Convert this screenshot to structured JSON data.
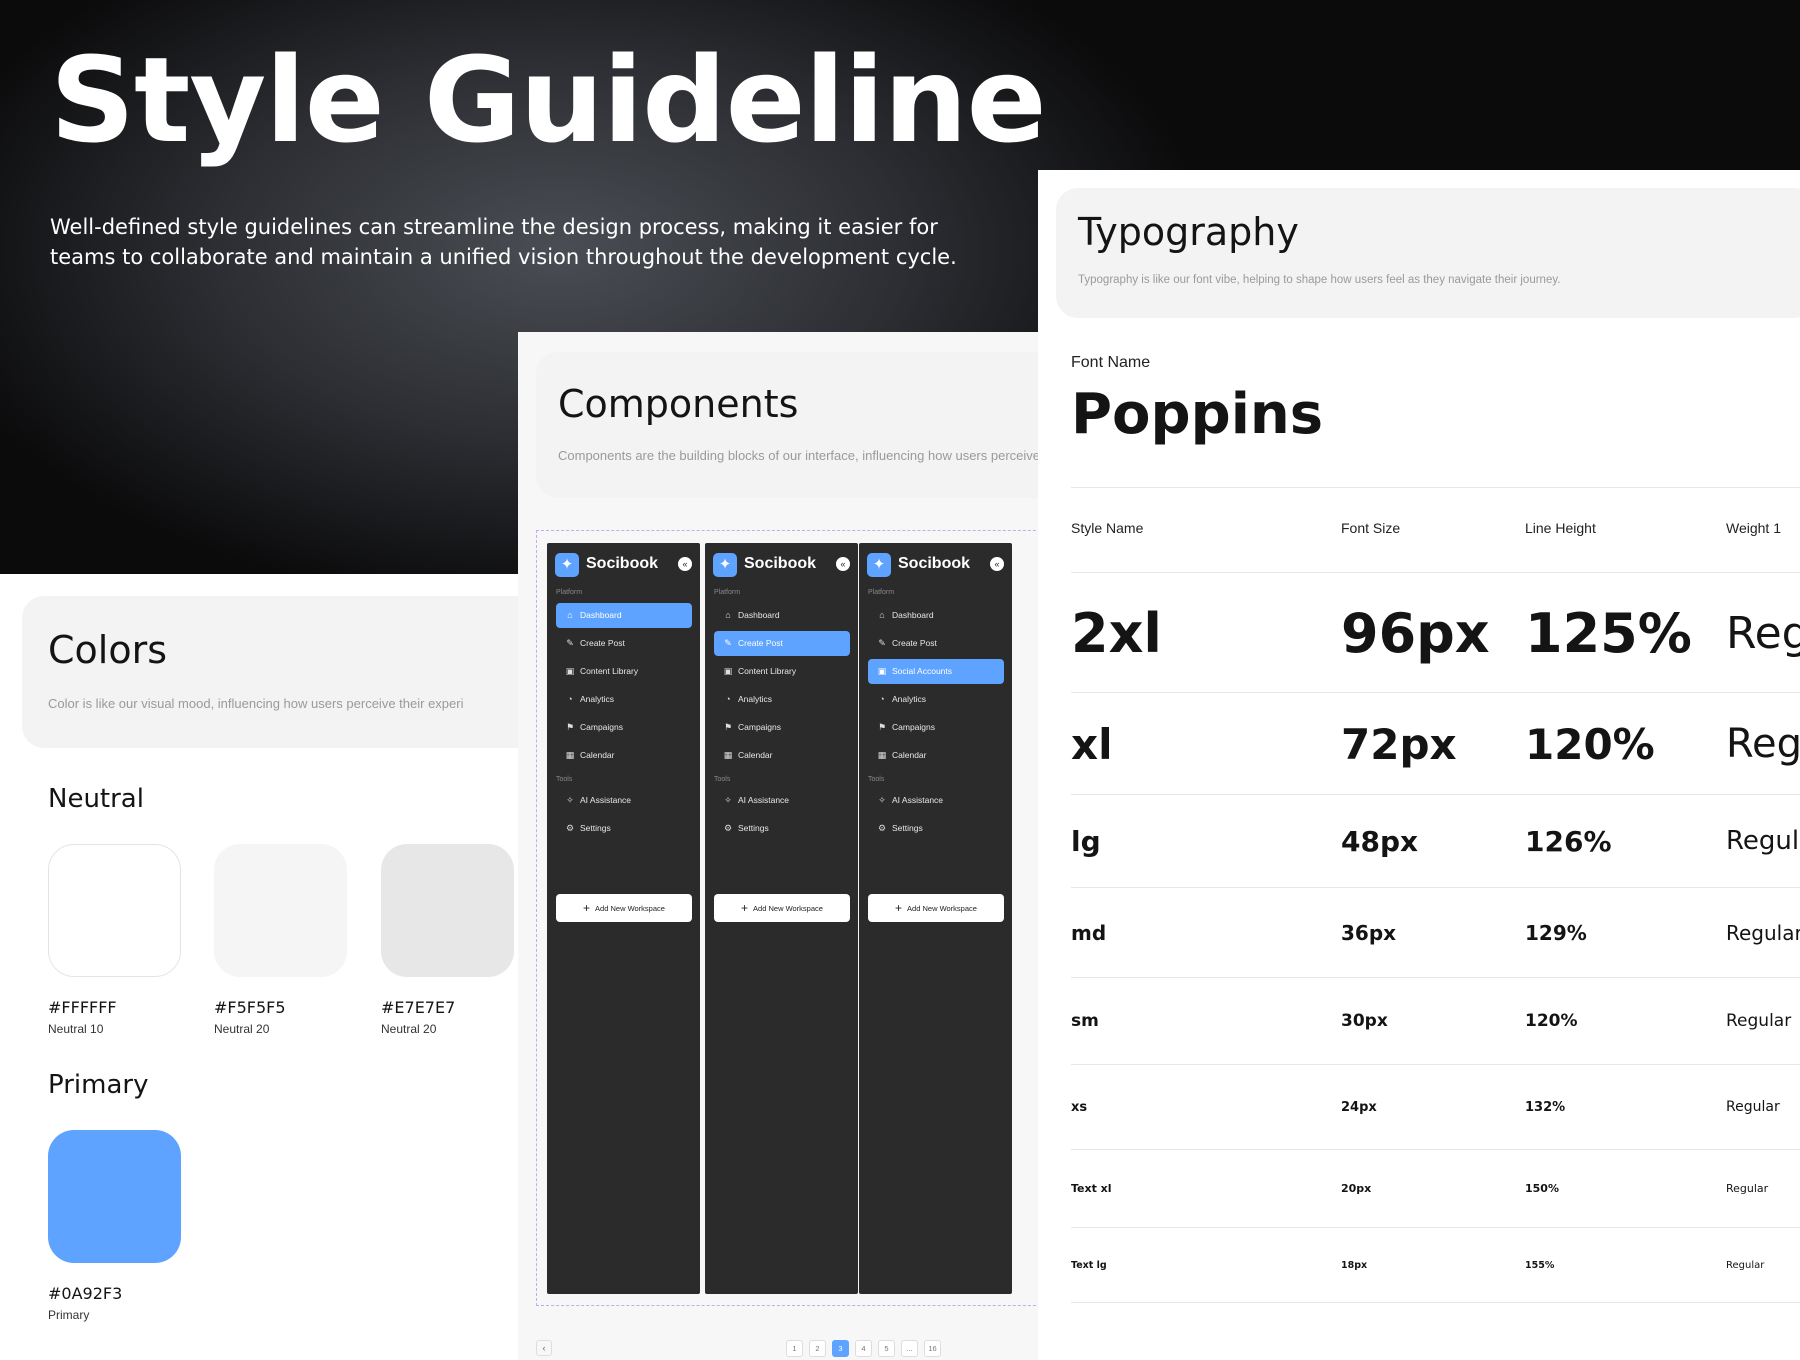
{
  "hero": {
    "title": "Style Guideline",
    "description": "Well-defined style guidelines can streamline the design process, making it easier for teams to collaborate and maintain a unified vision throughout the development cycle."
  },
  "colors": {
    "title": "Colors",
    "description": "Color is like our visual mood, influencing how users perceive their experi",
    "neutral": {
      "title": "Neutral",
      "swatches": [
        {
          "hex": "#FFFFFF",
          "name": "Neutral 10",
          "color": "#FFFFFF"
        },
        {
          "hex": "#F5F5F5",
          "name": "Neutral 20",
          "color": "#F5F5F5"
        },
        {
          "hex": "#E7E7E7",
          "name": "Neutral 20",
          "color": "#E7E7E7"
        }
      ]
    },
    "primary": {
      "title": "Primary",
      "swatches": [
        {
          "hex": "#0A92F3",
          "name": "Primary",
          "color": "#5EA3FF"
        }
      ]
    }
  },
  "components": {
    "title": "Components",
    "description": "Components are the building blocks of our interface, influencing how users perceive",
    "sidebars": [
      {
        "brand": "Socibook",
        "platform_label": "Platform",
        "tools_label": "Tools",
        "items": [
          "Dashboard",
          "Create Post",
          "Content Library",
          "Analytics",
          "Campaigns",
          "Calendar"
        ],
        "tool_items": [
          "AI Assistance",
          "Settings"
        ],
        "active": "Dashboard",
        "add_label": "Add New Workspace"
      },
      {
        "brand": "Socibook",
        "platform_label": "Platform",
        "tools_label": "Tools",
        "items": [
          "Dashboard",
          "Create Post",
          "Content Library",
          "Analytics",
          "Campaigns",
          "Calendar"
        ],
        "tool_items": [
          "AI Assistance",
          "Settings"
        ],
        "active": "Create Post",
        "add_label": "Add New Workspace"
      },
      {
        "brand": "Socibook",
        "platform_label": "Platform",
        "tools_label": "Tools",
        "items": [
          "Dashboard",
          "Create Post",
          "Social Accounts",
          "Analytics",
          "Campaigns",
          "Calendar"
        ],
        "tool_items": [
          "AI Assistance",
          "Settings"
        ],
        "active": "Social Accounts",
        "add_label": "Add New Workspace"
      }
    ],
    "pagination": {
      "prev": "‹",
      "pages": [
        "1",
        "2",
        "3",
        "4",
        "5",
        "...",
        "16"
      ],
      "current": "3"
    }
  },
  "typography": {
    "title": "Typography",
    "description": "Typography is like our font vibe, helping to shape how users feel as they navigate their journey.",
    "font_label": "Font Name",
    "font_name": "Poppins",
    "columns": [
      "Style Name",
      "Font Size",
      "Line Height",
      "Weight 1"
    ],
    "rows": [
      {
        "style": "2xl",
        "size": "96px",
        "line_height": "125%",
        "weight": "Regular"
      },
      {
        "style": "xl",
        "size": "72px",
        "line_height": "120%",
        "weight": "Regular"
      },
      {
        "style": "lg",
        "size": "48px",
        "line_height": "126%",
        "weight": "Regular"
      },
      {
        "style": "md",
        "size": "36px",
        "line_height": "129%",
        "weight": "Regular"
      },
      {
        "style": "sm",
        "size": "30px",
        "line_height": "120%",
        "weight": "Regular"
      },
      {
        "style": "xs",
        "size": "24px",
        "line_height": "132%",
        "weight": "Regular"
      },
      {
        "style": "Text xl",
        "size": "20px",
        "line_height": "150%",
        "weight": "Regular"
      },
      {
        "style": "Text lg",
        "size": "18px",
        "line_height": "155%",
        "weight": "Regular"
      }
    ]
  }
}
